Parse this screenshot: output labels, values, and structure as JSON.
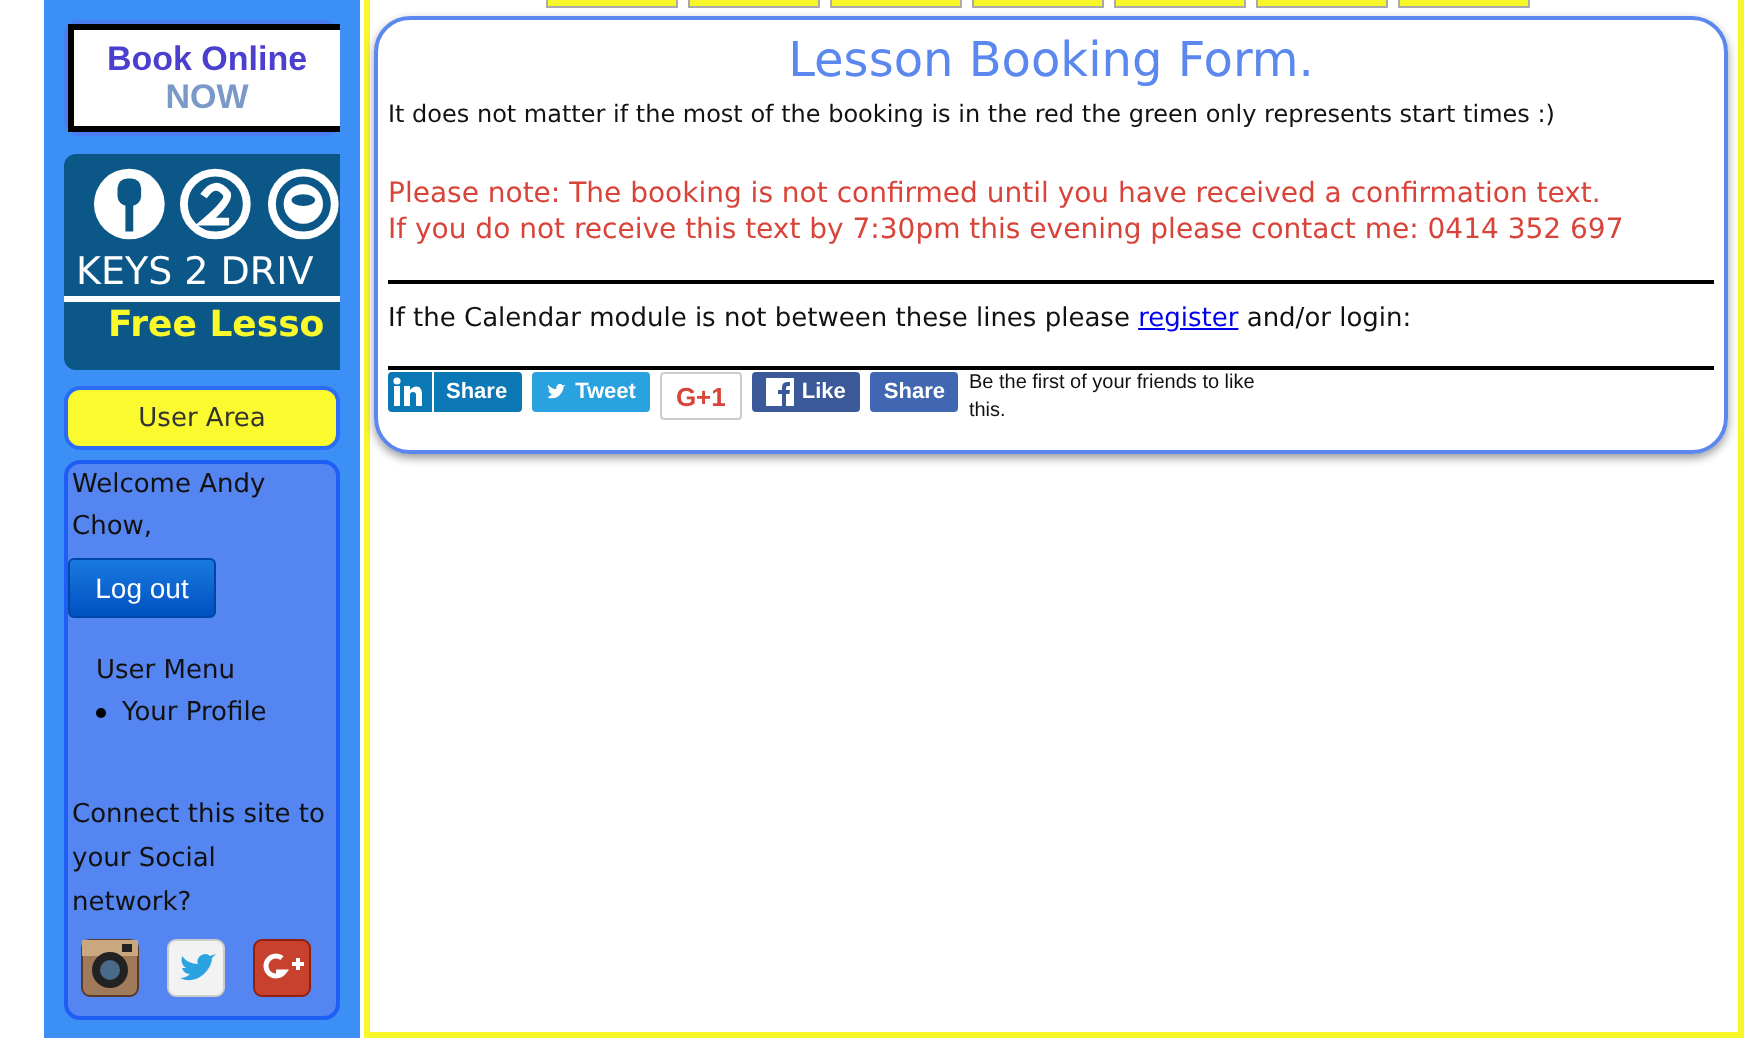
{
  "sidebar": {
    "book_online": {
      "line1": "Book Online",
      "line2": "NOW"
    },
    "logo": {
      "brand": "KEYS 2 DRIV",
      "tagline": "Free Lesso"
    },
    "user_area": "User Area",
    "welcome": "Welcome Andy Chow,",
    "logout": "Log out",
    "user_menu": {
      "title": "User Menu",
      "items": [
        "Your Profile"
      ]
    },
    "connect_text": "Connect this site to your Social network?",
    "social_icons": [
      {
        "kind": "instagram"
      },
      {
        "kind": "twitter"
      },
      {
        "kind": "googleplus"
      }
    ]
  },
  "card": {
    "title": "Lesson Booking Form.",
    "intro": "It does not matter if the most of the booking is in the red the green only represents start times :)",
    "notice": [
      "Please note: The booking is not confirmed until you have received a confirmation text.",
      "If you do not receive this text by 7:30pm this evening please contact me: 0414 352 697"
    ],
    "calendar_note": {
      "before": "If the Calendar module is not between these lines please",
      "link": "register",
      "after": "and/or login:"
    },
    "share_buttons": [
      {
        "kind": "linkedin",
        "label": "Share"
      },
      {
        "kind": "twitter",
        "label": "Tweet"
      },
      {
        "kind": "googleplus",
        "label": "G+1"
      },
      {
        "kind": "facebook",
        "label": "Like"
      },
      {
        "kind": "fbshare",
        "label": "Share"
      }
    ],
    "friends_text": "Be the first of your friends to like this."
  }
}
